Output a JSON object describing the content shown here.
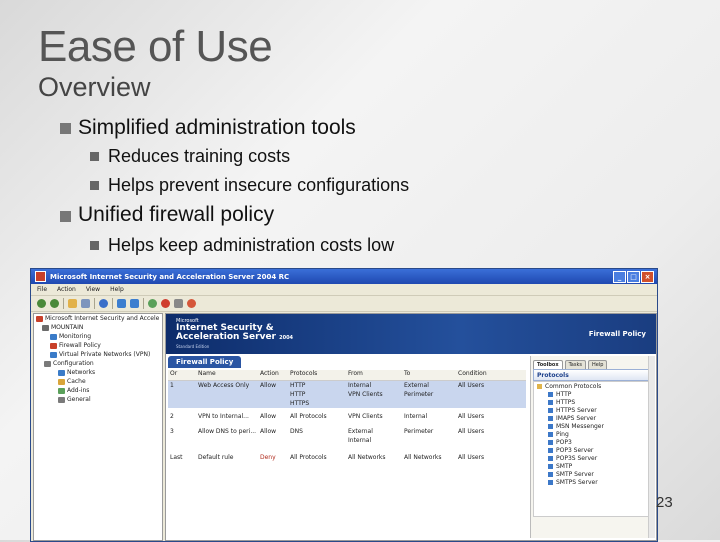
{
  "slide": {
    "title": "Ease of Use",
    "subtitle": "Overview",
    "bullets": [
      {
        "text": "Simplified administration tools",
        "sub": [
          "Reduces training costs",
          "Helps prevent insecure configurations"
        ]
      },
      {
        "text": "Unified firewall policy",
        "sub": [
          "Helps keep administration costs low"
        ]
      }
    ],
    "slide_number": "23"
  },
  "window": {
    "title": "Microsoft Internet Security and Acceleration Server 2004 RC",
    "controls": [
      "_",
      "□",
      "×"
    ],
    "menu": [
      "File",
      "Action",
      "View",
      "Help"
    ],
    "tree": [
      "Microsoft Internet Security and Accele",
      "MOUNTAIN",
      "Monitoring",
      "Firewall Policy",
      "Virtual Private Networks (VPN)",
      "Configuration",
      "Networks",
      "Cache",
      "Add-ins",
      "General"
    ],
    "banner": {
      "vendor": "Microsoft",
      "product_line1": "Internet Security &",
      "product_line2": "Acceleration Server",
      "year": "2004",
      "edition": "Standard Edition",
      "section": "Firewall Policy"
    },
    "policy_tab": "Firewall Policy",
    "columns": [
      "Or",
      "Name",
      "Action",
      "Protocols",
      "From",
      "To",
      "Condition"
    ],
    "rules": [
      {
        "order": "1",
        "name": "Web Access Only",
        "action": "Allow",
        "protocols": "HTTP",
        "from": "Internal",
        "to": "External",
        "condition": "All Users"
      },
      {
        "order": "",
        "name": "",
        "action": "",
        "protocols": "HTTP",
        "from": "VPN Clients",
        "to": "Perimeter",
        "condition": ""
      },
      {
        "order": "",
        "name": "",
        "action": "",
        "protocols": "HTTPS",
        "from": "",
        "to": "",
        "condition": ""
      },
      {
        "order": "2",
        "name": "VPN to Internal...",
        "action": "Allow",
        "protocols": "All Protocols",
        "from": "VPN Clients",
        "to": "Internal",
        "condition": "All Users"
      },
      {
        "order": "3",
        "name": "Allow DNS to peri...",
        "action": "Allow",
        "protocols": "DNS",
        "from": "External",
        "to": "Perimeter",
        "condition": "All Users"
      },
      {
        "order": "",
        "name": "",
        "action": "",
        "protocols": "",
        "from": "Internal",
        "to": "",
        "condition": ""
      },
      {
        "order": "Last",
        "name": "Default rule",
        "action": "Deny",
        "protocols": "All Protocols",
        "from": "All Networks",
        "to": "All Networks",
        "condition": "All Users"
      }
    ],
    "toolbox": {
      "tabs": [
        "Toolbox",
        "Tasks",
        "Help"
      ],
      "header": "Protocols",
      "items": [
        "Common Protocols",
        "HTTP",
        "HTTPS",
        "HTTPS Server",
        "IMAPS Server",
        "MSN Messenger",
        "Ping",
        "POP3",
        "POP3 Server",
        "POP3S Server",
        "SMTP",
        "SMTP Server",
        "SMTPS Server"
      ]
    }
  }
}
